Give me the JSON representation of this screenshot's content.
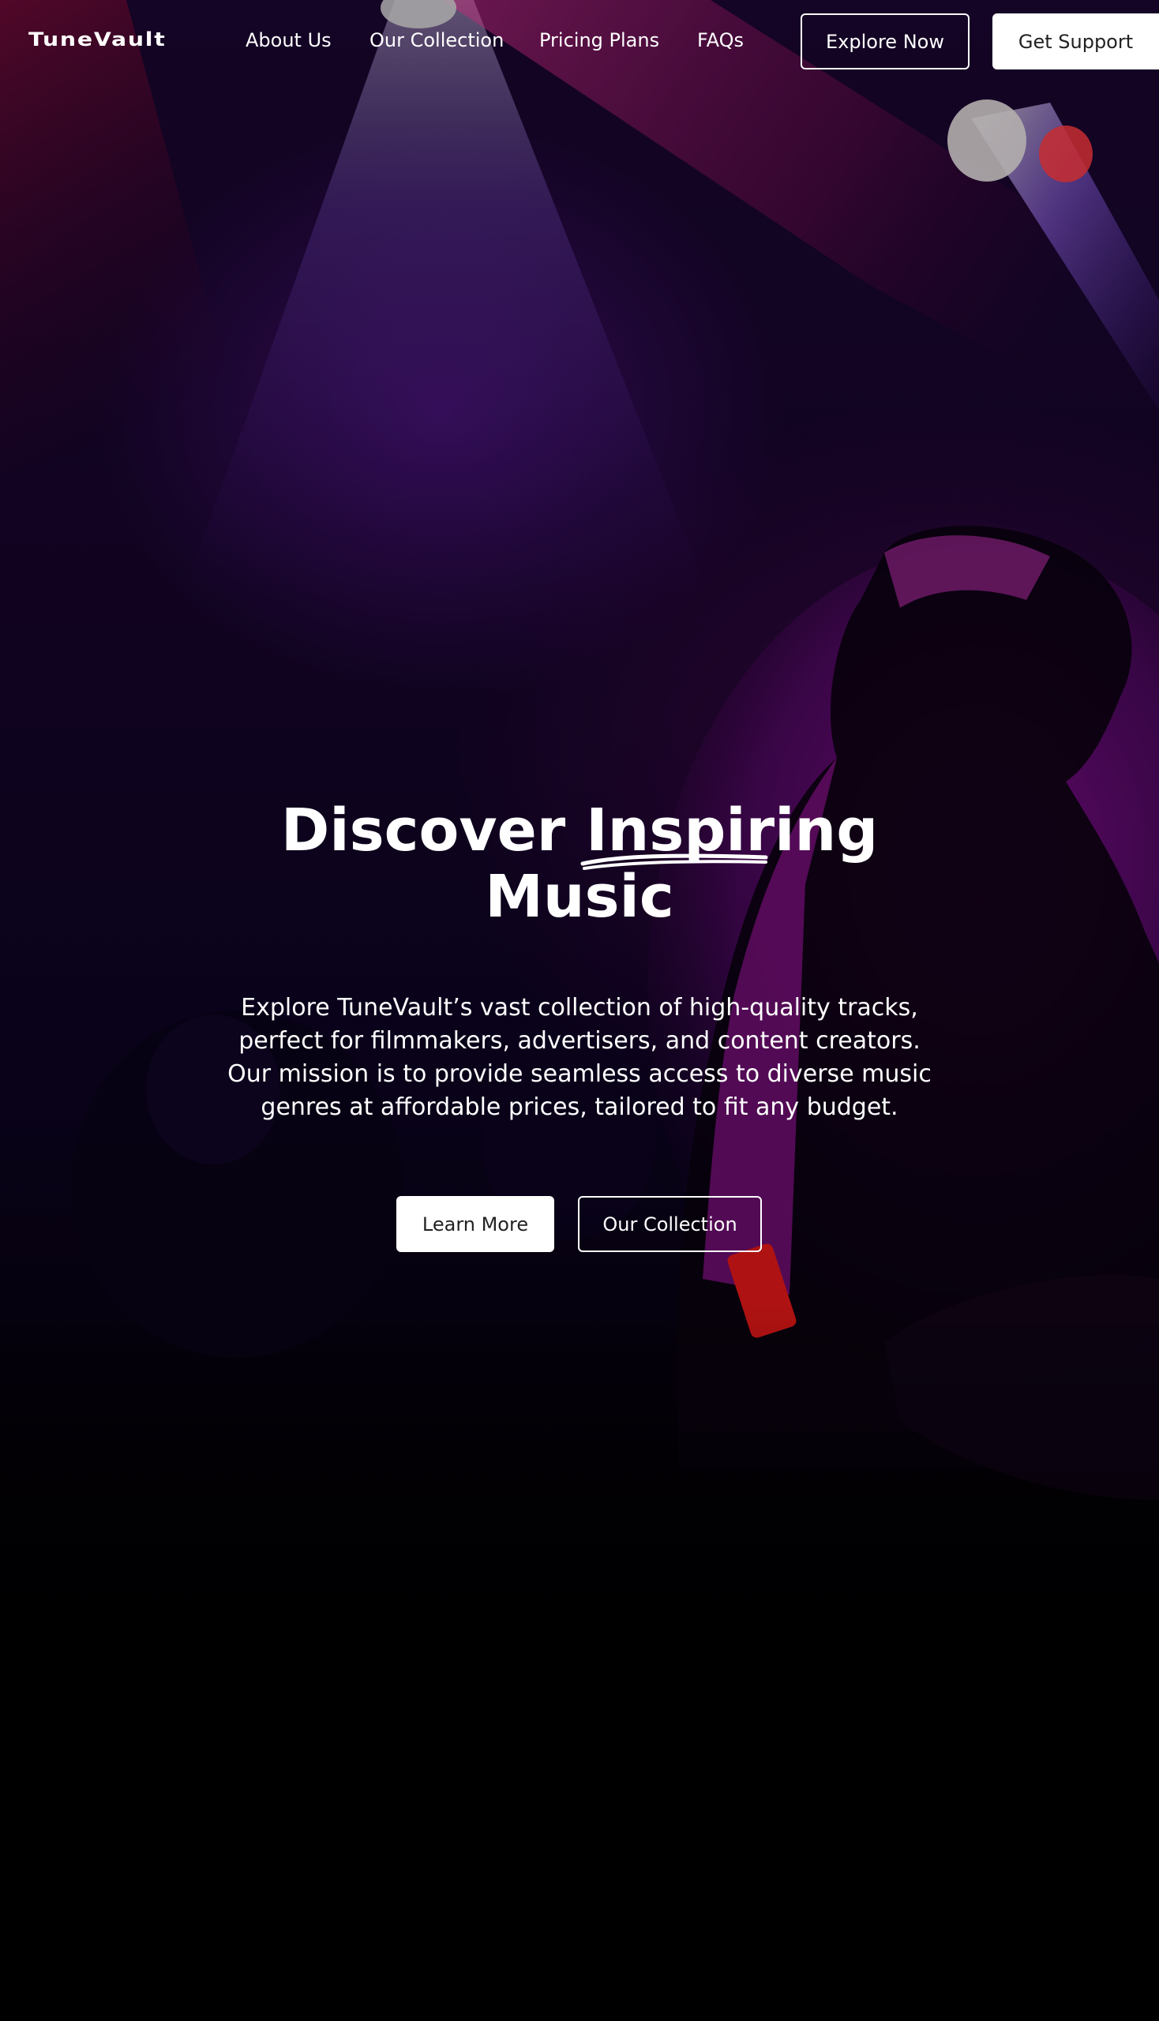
{
  "brand": {
    "logo_text": "TuneVault"
  },
  "nav": {
    "items": [
      {
        "label": "About Us"
      },
      {
        "label": "Our Collection"
      },
      {
        "label": "Pricing Plans"
      },
      {
        "label": "FAQs"
      }
    ]
  },
  "header_actions": {
    "explore_label": "Explore Now",
    "support_label": "Get Support"
  },
  "hero": {
    "title_part1": "Discover",
    "title_accent": "Inspiring",
    "title_line2": "Music",
    "description": "Explore TuneVault’s vast collection of high-quality tracks, perfect for filmmakers, advertisers, and content creators. Our mission is to provide seamless access to diverse music genres at affordable prices, tailored to fit any budget.",
    "primary_cta": "Learn More",
    "secondary_cta": "Our Collection"
  },
  "colors": {
    "text": "#ffffff",
    "solid_button_bg": "#ffffff",
    "solid_button_text": "#222222",
    "stage_purple": "#6a1aa8",
    "stage_magenta": "#c21aa8",
    "stage_red": "#b0103a"
  }
}
